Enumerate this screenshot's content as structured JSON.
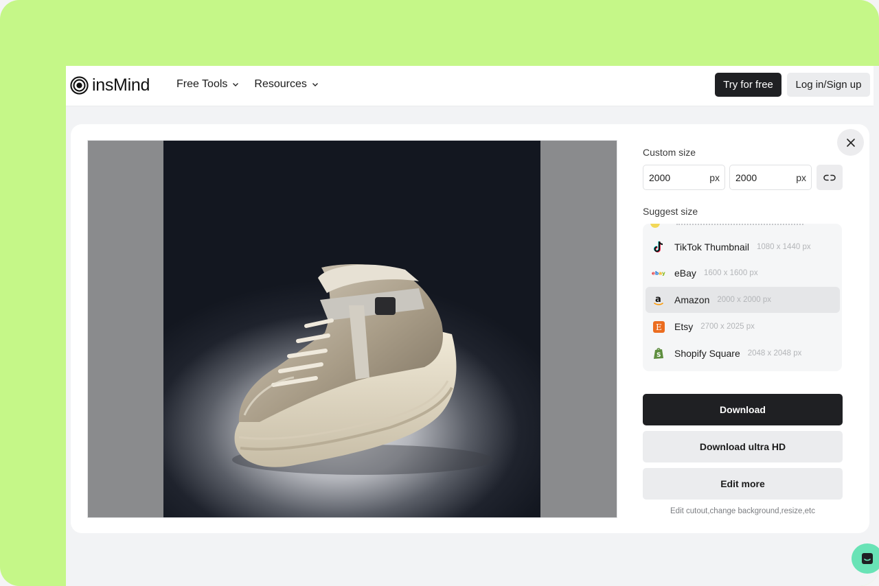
{
  "header": {
    "brand": "insMind",
    "nav": [
      {
        "label": "Free Tools"
      },
      {
        "label": "Resources"
      }
    ],
    "try_label": "Try for free",
    "login_label": "Log in/Sign up"
  },
  "panel": {
    "custom_size_label": "Custom size",
    "width_value": "2000",
    "height_value": "2000",
    "unit": "px",
    "suggest_size_label": "Suggest size",
    "suggestions": [
      {
        "name": "TikTok Thumbnail",
        "dims": "1080 x 1440 px",
        "icon": "tiktok-icon"
      },
      {
        "name": "eBay",
        "dims": "1600 x 1600 px",
        "icon": "ebay-icon"
      },
      {
        "name": "Amazon",
        "dims": "2000 x 2000 px",
        "icon": "amazon-icon",
        "selected": true
      },
      {
        "name": "Etsy",
        "dims": "2700 x 2025 px",
        "icon": "etsy-icon"
      },
      {
        "name": "Shopify Square",
        "dims": "2048 x 2048 px",
        "icon": "shopify-icon"
      }
    ],
    "download_label": "Download",
    "download_hd_label": "Download ultra HD",
    "edit_more_label": "Edit more",
    "edit_hint": "Edit cutout,change background,resize,etc"
  },
  "colors": {
    "frame": "#c5f788",
    "primary_button": "#1f2023",
    "selected_row": "#e5e6e8",
    "chat_bubble": "#69e3b6"
  }
}
